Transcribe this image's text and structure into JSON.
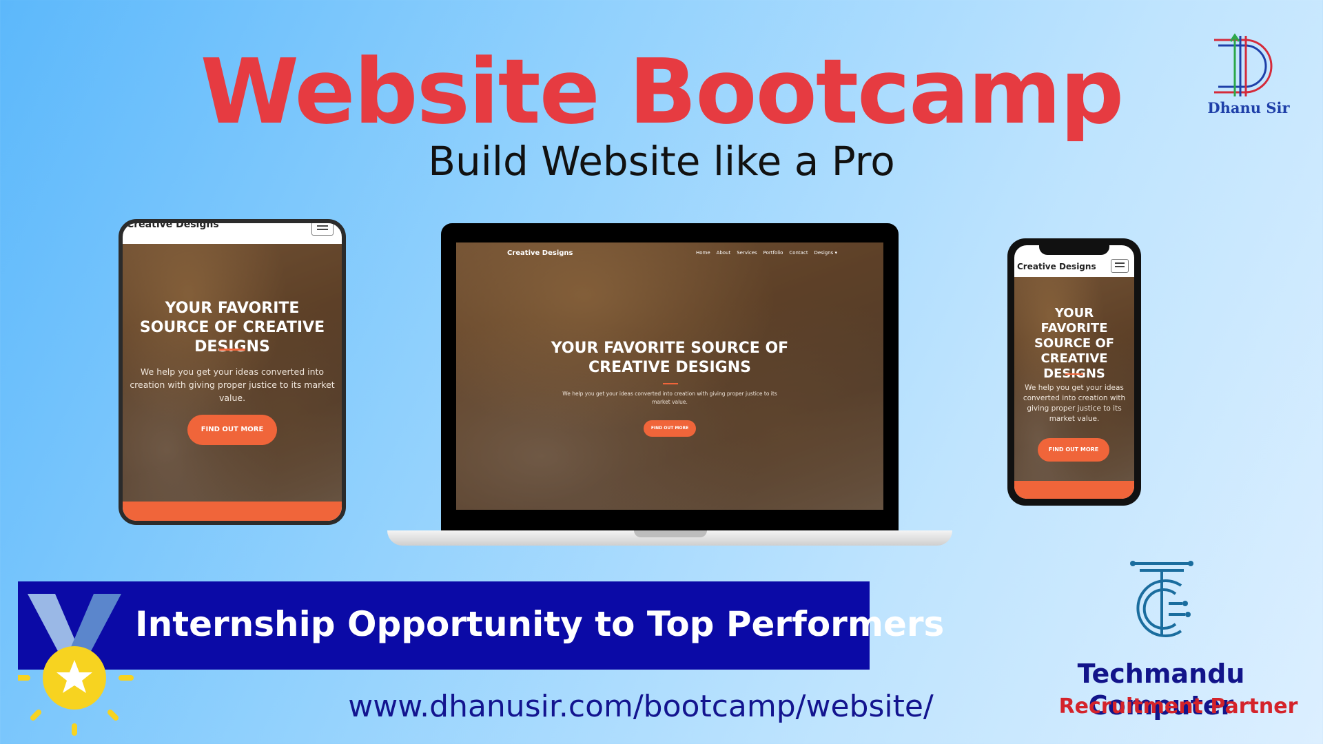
{
  "title": "Website Bootcamp",
  "subtitle": "Build Website like a Pro",
  "logo": {
    "name": "Dhanu Sir"
  },
  "mockup": {
    "brand": "Creative Designs",
    "nav": [
      "Home",
      "About",
      "Services",
      "Portfolio",
      "Contact",
      "Designs"
    ],
    "headline": "YOUR FAVORITE SOURCE OF CREATIVE DESIGNS",
    "description": "We help you get your ideas converted into creation with giving proper justice to its market value.",
    "cta": "FIND OUT MORE",
    "accent": "#f0653a"
  },
  "banner": {
    "text": "Internship Opportunity to Top Performers"
  },
  "url": "www.dhanusir.com/bootcamp/website/",
  "partner": {
    "company": "Techmandu Computer",
    "role": "Recruitment Partner"
  },
  "colors": {
    "title": "#e63b41",
    "banner": "#0b0aa6",
    "partner_role": "#d4232a"
  }
}
